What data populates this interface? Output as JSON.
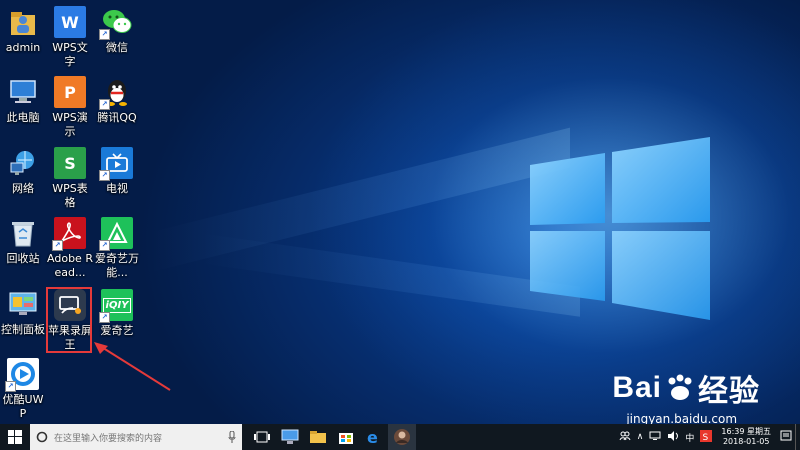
{
  "desktop": {
    "icons": [
      {
        "label": "admin",
        "icon": "user-folder-icon",
        "shortcut": false
      },
      {
        "label": "WPS文字",
        "icon": "wps-writer-icon",
        "shortcut": true
      },
      {
        "label": "微信",
        "icon": "wechat-icon",
        "shortcut": true
      },
      {
        "label": "此电脑",
        "icon": "computer-icon",
        "shortcut": false
      },
      {
        "label": "WPS演示",
        "icon": "wps-presentation-icon",
        "shortcut": true
      },
      {
        "label": "腾讯QQ",
        "icon": "qq-icon",
        "shortcut": true
      },
      {
        "label": "网络",
        "icon": "network-icon",
        "shortcut": false
      },
      {
        "label": "WPS表格",
        "icon": "wps-spreadsheet-icon",
        "shortcut": true
      },
      {
        "label": "电视",
        "icon": "tv-icon",
        "shortcut": true
      },
      {
        "label": "回收站",
        "icon": "recycle-bin-icon",
        "shortcut": false
      },
      {
        "label": "Adobe Read...",
        "icon": "adobe-reader-icon",
        "shortcut": true
      },
      {
        "label": "爱奇艺万能...",
        "icon": "iqiyi-player-icon",
        "shortcut": true
      },
      {
        "label": "控制面板",
        "icon": "control-panel-icon",
        "shortcut": false
      },
      {
        "label": "苹果录屏王",
        "icon": "screen-recorder-icon",
        "shortcut": true
      },
      {
        "label": "爱奇艺",
        "icon": "iqiyi-icon",
        "shortcut": true
      },
      {
        "label": "优酷UWP",
        "icon": "youku-icon",
        "shortcut": true
      }
    ],
    "icon_glyphs": {
      "wps_writer": "W",
      "wps_presentation": "P",
      "wps_spreadsheet": "S",
      "iqiyi": "iQIY"
    }
  },
  "taskbar": {
    "search_placeholder": "在这里输入你要搜索的内容",
    "tray": {
      "ime": "中",
      "clock_time": "16:39 星期五",
      "clock_date": "2018-01-05"
    }
  },
  "watermark": {
    "logo_text_1": "Bai",
    "logo_text_2": "经验",
    "url": "jingyan.baidu.com"
  },
  "colors": {
    "highlight": "#e53a3a",
    "wps_writer": "#2b7be4",
    "wps_presentation": "#f07a26",
    "wps_spreadsheet": "#2aa04a",
    "adobe": "#c9121d",
    "iqiyi": "#1ec15a",
    "tv": "#1a7ad8",
    "youku": "#1e88e5"
  }
}
